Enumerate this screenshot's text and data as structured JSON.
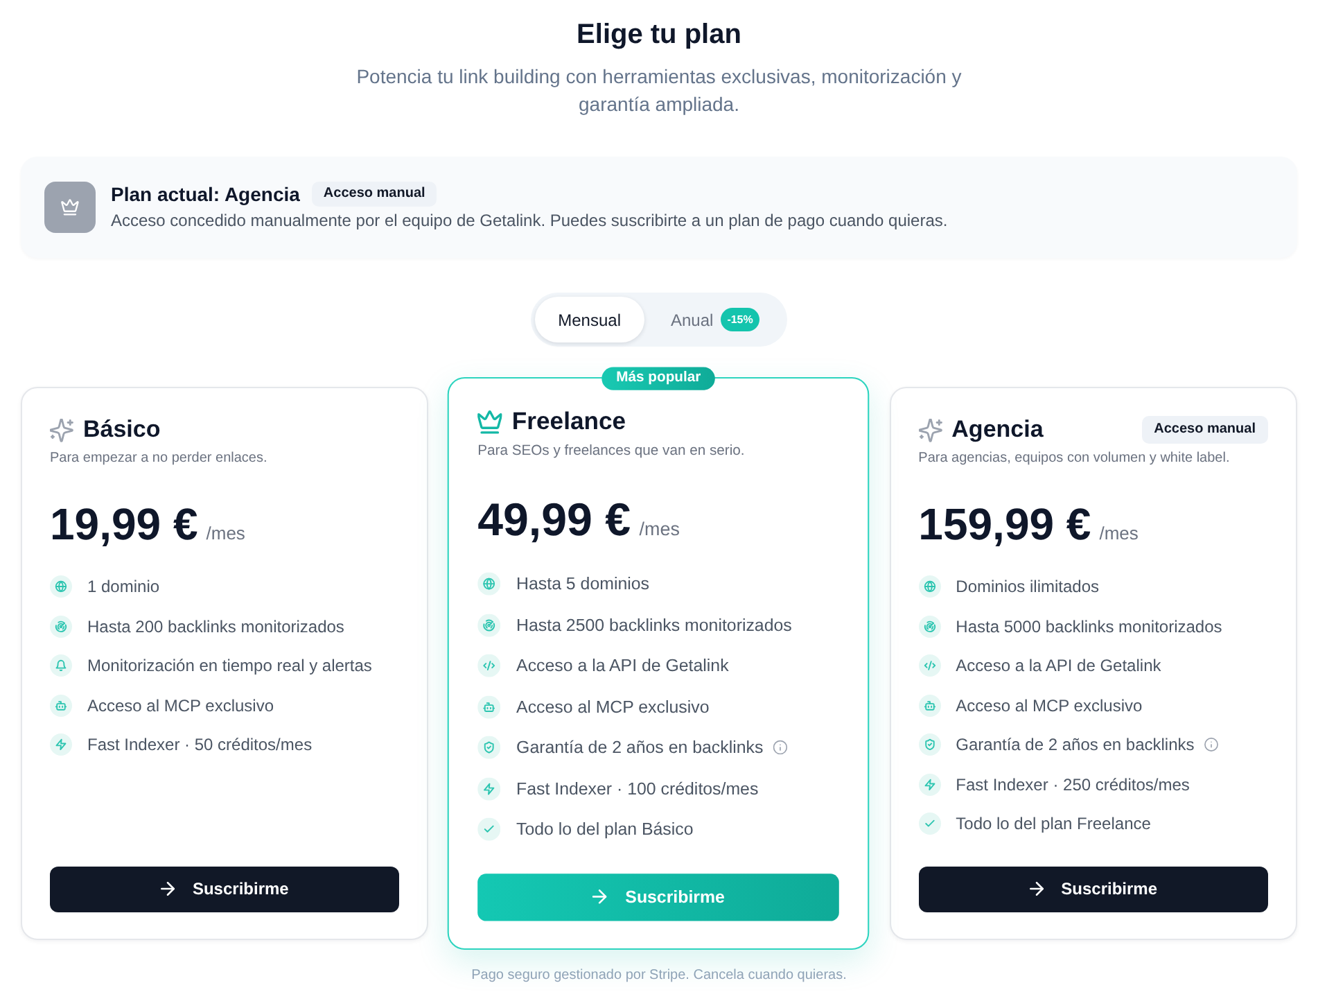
{
  "header": {
    "title": "Elige tu plan",
    "subtitle": "Potencia tu link building con herramientas exclusivas, monitorización y garantía ampliada."
  },
  "current_plan": {
    "title": "Plan actual: Agencia",
    "badge": "Acceso manual",
    "description": "Acceso concedido manualmente por el equipo de Getalink. Puedes suscribirte a un plan de pago cuando quieras."
  },
  "billing_toggle": [
    {
      "label": "Mensual",
      "selected": true
    },
    {
      "label": "Anual",
      "selected": false,
      "badge": "-15%"
    }
  ],
  "plans": [
    {
      "name": "Básico",
      "featured": false,
      "description": "Para empezar a no perder enlaces.",
      "price": "19,99 €",
      "period": "/mes",
      "features": [
        {
          "kind": "domains",
          "text": "1 dominio",
          "info": false
        },
        {
          "kind": "backlinks",
          "text": "Hasta 200 backlinks monitorizados",
          "info": false
        },
        {
          "kind": "alerts",
          "text": "Monitorización en tiempo real y alertas",
          "info": false
        },
        {
          "kind": "mcp",
          "text": "Acceso al MCP exclusivo",
          "info": false
        },
        {
          "kind": "indexer",
          "text": "Fast Indexer · 50 créditos/mes",
          "info": false
        }
      ],
      "button": "Suscribirme"
    },
    {
      "name": "Freelance",
      "featured": true,
      "ribbon": "Más popular",
      "description": "Para SEOs y freelances que van en serio.",
      "price": "49,99 €",
      "period": "/mes",
      "features": [
        {
          "kind": "domains",
          "text": "Hasta 5 dominios",
          "info": false
        },
        {
          "kind": "backlinks",
          "text": "Hasta 2500 backlinks monitorizados",
          "info": false
        },
        {
          "kind": "api",
          "text": "Acceso a la API de Getalink",
          "info": false
        },
        {
          "kind": "mcp",
          "text": "Acceso al MCP exclusivo",
          "info": false
        },
        {
          "kind": "guarantee",
          "text": "Garantía de 2 años en backlinks",
          "info": true
        },
        {
          "kind": "indexer",
          "text": "Fast Indexer · 100 créditos/mes",
          "info": false
        },
        {
          "kind": "includes",
          "text": "Todo lo del plan Básico",
          "info": false
        }
      ],
      "button": "Suscribirme"
    },
    {
      "name": "Agencia",
      "featured": false,
      "tag": "Acceso manual",
      "description": "Para agencias, equipos con volumen y white label.",
      "price": "159,99 €",
      "period": "/mes",
      "features": [
        {
          "kind": "domains",
          "text": "Dominios ilimitados",
          "info": false
        },
        {
          "kind": "backlinks",
          "text": "Hasta 5000 backlinks monitorizados",
          "info": false
        },
        {
          "kind": "api",
          "text": "Acceso a la API de Getalink",
          "info": false
        },
        {
          "kind": "mcp",
          "text": "Acceso al MCP exclusivo",
          "info": false
        },
        {
          "kind": "guarantee",
          "text": "Garantía de 2 años en backlinks",
          "info": true
        },
        {
          "kind": "indexer",
          "text": "Fast Indexer · 250 créditos/mes",
          "info": false
        },
        {
          "kind": "includes",
          "text": "Todo lo del plan Freelance",
          "info": false
        }
      ],
      "button": "Suscribirme"
    }
  ],
  "footer": "Pago seguro gestionado por Stripe. Cancela cuando quieras."
}
